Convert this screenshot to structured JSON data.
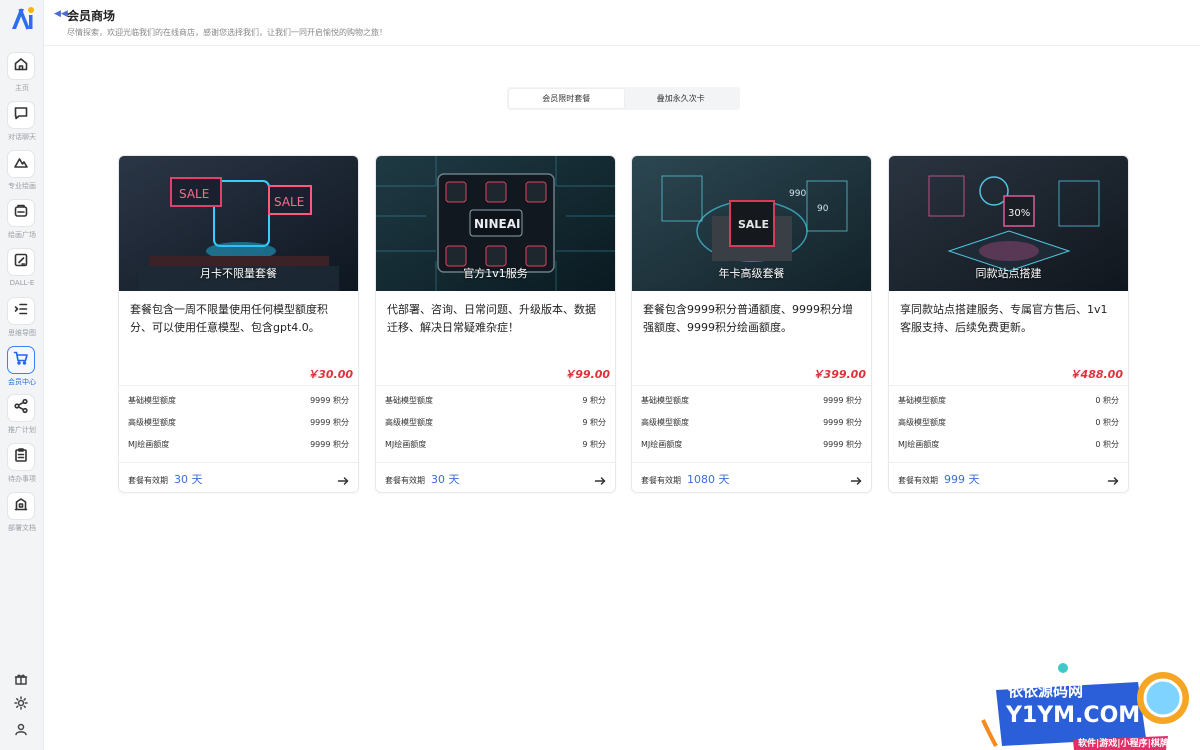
{
  "sidebar": {
    "items": [
      {
        "label": "主页",
        "icon": "home-icon"
      },
      {
        "label": "对话聊天",
        "icon": "chat-icon"
      },
      {
        "label": "专业绘画",
        "icon": "mountain-icon"
      },
      {
        "label": "绘画广场",
        "icon": "gallery-icon"
      },
      {
        "label": "DALL-E",
        "icon": "edit-icon"
      },
      {
        "label": "思维导图",
        "icon": "mindmap-icon"
      },
      {
        "label": "会员中心",
        "icon": "cart-icon"
      },
      {
        "label": "推广计划",
        "icon": "share-icon"
      },
      {
        "label": "待办事项",
        "icon": "clipboard-icon"
      },
      {
        "label": "部署文档",
        "icon": "building-icon"
      }
    ],
    "footer_icons": [
      "gift-icon",
      "sun-icon",
      "user-icon"
    ],
    "active_index": 6
  },
  "header": {
    "title": "会员商场",
    "subtitle": "尽情探索，欢迎光临我们的在线商店，感谢您选择我们，让我们一同开启愉悦的购物之旅！"
  },
  "tabs": [
    {
      "label": "会员限时套餐",
      "active": true
    },
    {
      "label": "叠加永久次卡",
      "active": false
    }
  ],
  "row_labels": [
    "基础模型额度",
    "高级模型额度",
    "MJ绘画额度"
  ],
  "validity_label": "套餐有效期",
  "cards": [
    {
      "name": "月卡不限量套餐",
      "description": "套餐包含一周不限量使用任何模型额度积分、可以使用任意模型、包含gpt4.0。",
      "price": "￥30.00",
      "rows": [
        "9999 积分",
        "9999 积分",
        "9999 积分"
      ],
      "validity": "30 天",
      "image_text": "SALE"
    },
    {
      "name": "官方1v1服务",
      "description": "代部署、咨询、日常问题、升级版本、数据迁移、解决日常疑难杂症！",
      "price": "￥99.00",
      "rows": [
        "9 积分",
        "9 积分",
        "9 积分"
      ],
      "validity": "30 天",
      "image_text": "NINEAI"
    },
    {
      "name": "年卡高级套餐",
      "description": "套餐包含9999积分普通额度、9999积分增强额度、9999积分绘画额度。",
      "price": "￥399.00",
      "rows": [
        "9999 积分",
        "9999 积分",
        "9999 积分"
      ],
      "validity": "1080 天",
      "image_text": "SALE"
    },
    {
      "name": "同款站点搭建",
      "description": "享同款站点搭建服务、专属官方售后、1v1客服支持、后续免费更新。",
      "price": "￥488.00",
      "rows": [
        "0 积分",
        "0 积分",
        "0 积分"
      ],
      "validity": "999 天",
      "image_text": "30%"
    }
  ],
  "watermark": {
    "title": "依依源码网",
    "domain": "Y1YM.COM",
    "tagline": "软件|游戏|小程序|棋牌"
  },
  "colors": {
    "accent": "#2563eb",
    "price": "#e0303b",
    "validity": "#3b6fd8"
  }
}
